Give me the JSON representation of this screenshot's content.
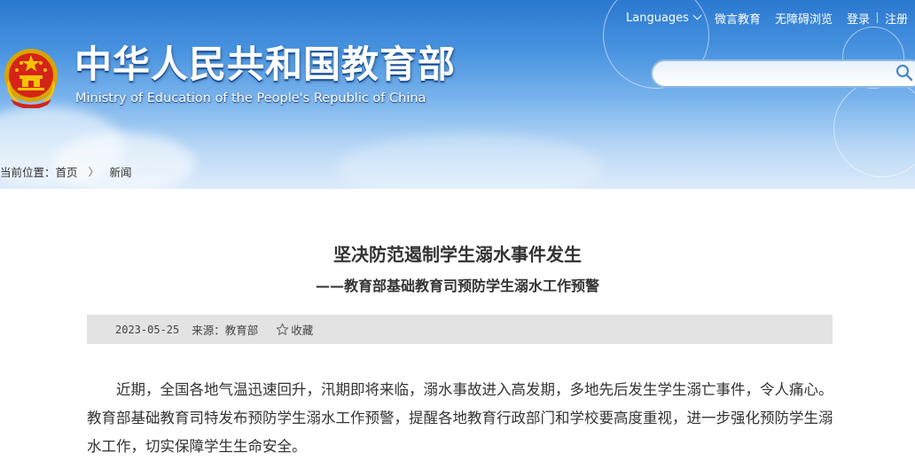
{
  "header": {
    "site_title": "中华人民共和国教育部",
    "site_subtitle": "Ministry of Education of the People's Republic of China",
    "nav": {
      "languages": "Languages",
      "weiyan": "微言教育",
      "accessibility": "无障碍浏览",
      "login": "登录",
      "register": "注册"
    },
    "search_placeholder": ""
  },
  "breadcrumb": {
    "prefix": "当前位置：",
    "home": "首页",
    "separator": "〉",
    "current": "新闻"
  },
  "article": {
    "title": "坚决防范遏制学生溺水事件发生",
    "subtitle": "——教育部基础教育司预防学生溺水工作预警",
    "date": "2023-05-25",
    "source": "来源：教育部",
    "favorite": "收藏",
    "body": "近期，全国各地气温迅速回升，汛期即将来临，溺水事故进入高发期，多地先后发生学生溺亡事件，令人痛心。教育部基础教育司特发布预防学生溺水工作预警，提醒各地教育行政部门和学校要高度重视，进一步强化预防学生溺水工作，切实保障学生生命安全。"
  },
  "colors": {
    "header_top": "#2a78d0",
    "header_bottom": "#dcebfa",
    "meta_bar": "#e3e3e3",
    "text": "#333333"
  },
  "icons": [
    "emblem-icon",
    "chevron-down-icon",
    "search-icon",
    "star-icon"
  ]
}
